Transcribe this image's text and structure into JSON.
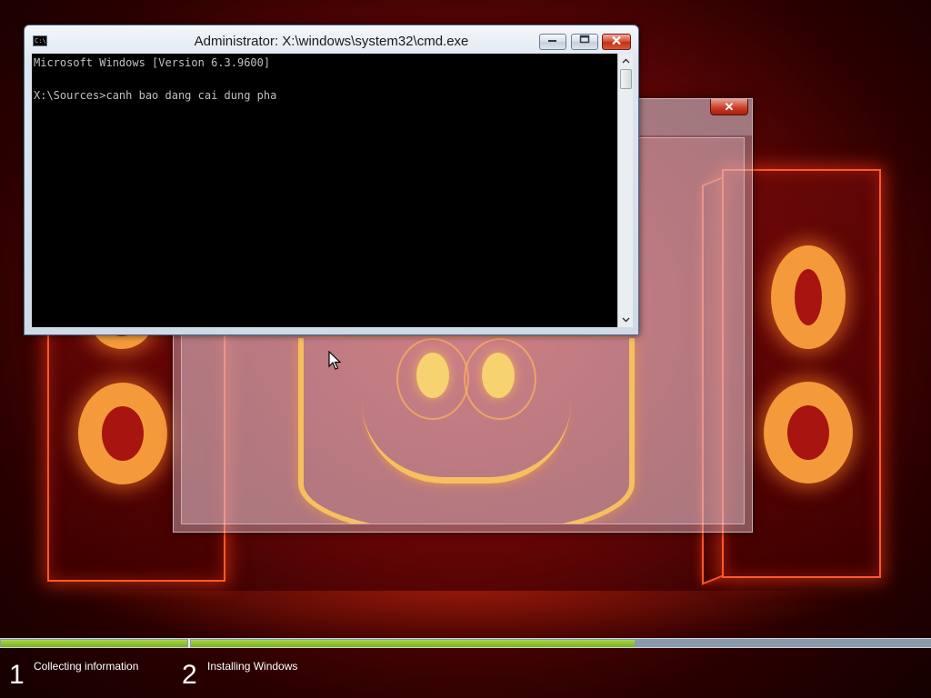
{
  "cmd_window": {
    "title": "Administrator: X:\\windows\\system32\\cmd.exe",
    "icon": "console-icon",
    "icon_text": "C:\\.",
    "lines": [
      "Microsoft Windows [Version 6.3.9600]",
      "",
      "X:\\Sources>canh bao dang cai dung pha"
    ]
  },
  "setup_window": {
    "close_glyph": "✕"
  },
  "setup_progress": {
    "step1_complete_fraction": 1.0,
    "step2_complete_fraction": 0.6
  },
  "steps": [
    {
      "number": "1",
      "label": "Collecting information"
    },
    {
      "number": "2",
      "label": "Installing Windows"
    }
  ],
  "colors": {
    "progress_fill": "#8bc53f",
    "progress_track": "#8a9aaa",
    "console_bg": "#000000",
    "console_text": "#c0c0c0"
  }
}
